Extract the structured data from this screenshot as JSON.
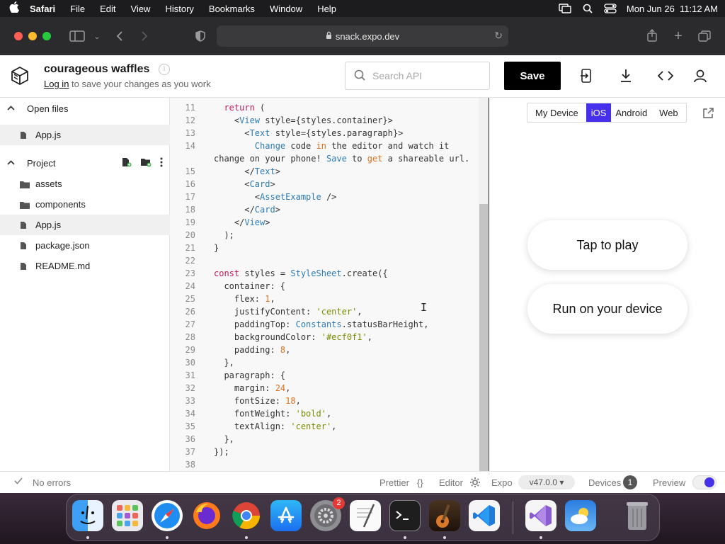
{
  "menubar": {
    "app_name": "Safari",
    "items": [
      "File",
      "Edit",
      "View",
      "History",
      "Bookmarks",
      "Window",
      "Help"
    ],
    "clock": "Mon Jun 26  11:12 AM"
  },
  "browser": {
    "url": "snack.expo.dev"
  },
  "header": {
    "project_name": "courageous waffles",
    "login_link": "Log in",
    "login_suffix": " to save your changes as you work",
    "search_placeholder": "Search API",
    "save_label": "Save"
  },
  "sidebar": {
    "open_files_title": "Open files",
    "open_files": [
      "App.js"
    ],
    "project_title": "Project",
    "project_items": [
      {
        "label": "assets",
        "type": "folder"
      },
      {
        "label": "components",
        "type": "folder"
      },
      {
        "label": "App.js",
        "type": "file"
      },
      {
        "label": "package.json",
        "type": "file"
      },
      {
        "label": "README.md",
        "type": "file"
      }
    ]
  },
  "editor": {
    "code_lines": [
      {
        "n": "11",
        "text": "  return ("
      },
      {
        "n": "12",
        "text": "    <View style={styles.container}>"
      },
      {
        "n": "13",
        "text": "      <Text style={styles.paragraph}>"
      },
      {
        "n": "14",
        "text": "        Change code in the editor and watch it"
      },
      {
        "n": "",
        "text": "change on your phone! Save to get a shareable url."
      },
      {
        "n": "15",
        "text": "      </Text>"
      },
      {
        "n": "16",
        "text": "      <Card>"
      },
      {
        "n": "17",
        "text": "        <AssetExample />"
      },
      {
        "n": "18",
        "text": "      </Card>"
      },
      {
        "n": "19",
        "text": "    </View>"
      },
      {
        "n": "20",
        "text": "  );"
      },
      {
        "n": "21",
        "text": "}"
      },
      {
        "n": "22",
        "text": ""
      },
      {
        "n": "23",
        "text": "const styles = StyleSheet.create({"
      },
      {
        "n": "24",
        "text": "  container: {"
      },
      {
        "n": "25",
        "text": "    flex: 1,"
      },
      {
        "n": "26",
        "text": "    justifyContent: 'center',"
      },
      {
        "n": "27",
        "text": "    paddingTop: Constants.statusBarHeight,"
      },
      {
        "n": "28",
        "text": "    backgroundColor: '#ecf0f1',"
      },
      {
        "n": "29",
        "text": "    padding: 8,"
      },
      {
        "n": "30",
        "text": "  },"
      },
      {
        "n": "31",
        "text": "  paragraph: {"
      },
      {
        "n": "32",
        "text": "    margin: 24,"
      },
      {
        "n": "33",
        "text": "    fontSize: 18,"
      },
      {
        "n": "34",
        "text": "    fontWeight: 'bold',"
      },
      {
        "n": "35",
        "text": "    textAlign: 'center',"
      },
      {
        "n": "36",
        "text": "  },"
      },
      {
        "n": "37",
        "text": "});"
      },
      {
        "n": "38",
        "text": ""
      }
    ]
  },
  "preview": {
    "tabs": [
      "My Device",
      "iOS",
      "Android",
      "Web"
    ],
    "active_tab": "iOS",
    "tap_to_play": "Tap to play",
    "run_on_device": "Run on your device"
  },
  "statusbar": {
    "errors": "No errors",
    "prettier": "Prettier",
    "prettier_icon": "{}",
    "editor": "Editor",
    "expo": "Expo",
    "sdk_version": "v47.0.0 ▾",
    "devices": "Devices",
    "devices_count": "1",
    "preview": "Preview"
  },
  "dock": {
    "apps": [
      "Finder",
      "Launchpad",
      "Safari",
      "Firefox",
      "Chrome",
      "App Store",
      "System Preferences",
      "TextEdit",
      "Terminal",
      "GarageBand",
      "Visual Studio Code",
      "Visual Studio",
      "Weather",
      "Trash"
    ],
    "badge": "2"
  },
  "colors": {
    "accent": "#4630eb",
    "save_bg": "#000000",
    "editor_bg": "#f8f8f8"
  }
}
